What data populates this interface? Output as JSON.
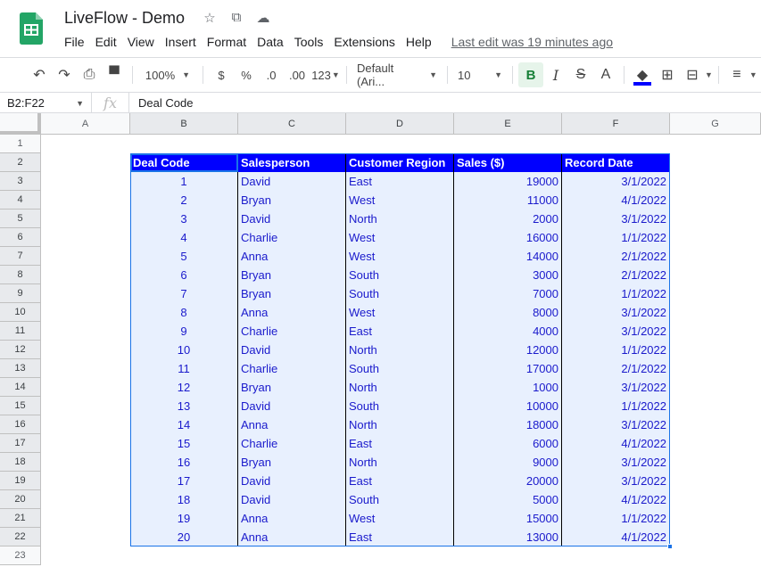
{
  "app": {
    "title": "LiveFlow - Demo",
    "title_icons": [
      "star-icon",
      "move-to-folder-icon",
      "cloud-saved-icon"
    ],
    "menu": [
      "File",
      "Edit",
      "View",
      "Insert",
      "Format",
      "Data",
      "Tools",
      "Extensions",
      "Help"
    ],
    "last_edit": "Last edit was 19 minutes ago"
  },
  "toolbar": {
    "undo": "↶",
    "redo": "↷",
    "print": "⎙",
    "paint_format": "🖌",
    "zoom": "100%",
    "currency": "$",
    "percent": "%",
    "decrease_decimal": ".0",
    "increase_decimal": ".00",
    "more_formats": "123",
    "font": "Default (Ari...",
    "font_size": "10",
    "bold": "B",
    "italic": "I",
    "strikethrough": "S",
    "text_color": "A",
    "fill_color": "#0000ff"
  },
  "formula_bar": {
    "name_box": "B2:F22",
    "fx": "fx",
    "value": "Deal Code"
  },
  "grid": {
    "columns": [
      "A",
      "B",
      "C",
      "D",
      "E",
      "F",
      "G"
    ],
    "rows": [
      "1",
      "2",
      "3",
      "4",
      "5",
      "6",
      "7",
      "8",
      "9",
      "10",
      "11",
      "12",
      "13",
      "14",
      "15",
      "16",
      "17",
      "18",
      "19",
      "20",
      "21",
      "22",
      "23"
    ],
    "selected_range": "B2:F22"
  },
  "table": {
    "headers": [
      "Deal Code",
      "Salesperson",
      "Customer Region",
      "Sales ($)",
      "Record Date"
    ],
    "rows": [
      [
        "1",
        "David",
        "East",
        "19000",
        "3/1/2022"
      ],
      [
        "2",
        "Bryan",
        "West",
        "11000",
        "4/1/2022"
      ],
      [
        "3",
        "David",
        "North",
        "2000",
        "3/1/2022"
      ],
      [
        "4",
        "Charlie",
        "West",
        "16000",
        "1/1/2022"
      ],
      [
        "5",
        "Anna",
        "West",
        "14000",
        "2/1/2022"
      ],
      [
        "6",
        "Bryan",
        "South",
        "3000",
        "2/1/2022"
      ],
      [
        "7",
        "Bryan",
        "South",
        "7000",
        "1/1/2022"
      ],
      [
        "8",
        "Anna",
        "West",
        "8000",
        "3/1/2022"
      ],
      [
        "9",
        "Charlie",
        "East",
        "4000",
        "3/1/2022"
      ],
      [
        "10",
        "David",
        "North",
        "12000",
        "1/1/2022"
      ],
      [
        "11",
        "Charlie",
        "South",
        "17000",
        "2/1/2022"
      ],
      [
        "12",
        "Bryan",
        "North",
        "1000",
        "3/1/2022"
      ],
      [
        "13",
        "David",
        "South",
        "10000",
        "1/1/2022"
      ],
      [
        "14",
        "Anna",
        "North",
        "18000",
        "3/1/2022"
      ],
      [
        "15",
        "Charlie",
        "East",
        "6000",
        "4/1/2022"
      ],
      [
        "16",
        "Bryan",
        "North",
        "9000",
        "3/1/2022"
      ],
      [
        "17",
        "David",
        "East",
        "20000",
        "3/1/2022"
      ],
      [
        "18",
        "David",
        "South",
        "5000",
        "4/1/2022"
      ],
      [
        "19",
        "Anna",
        "West",
        "15000",
        "1/1/2022"
      ],
      [
        "20",
        "Anna",
        "East",
        "13000",
        "4/1/2022"
      ]
    ]
  },
  "colors": {
    "header_fill": "#0000ff",
    "header_text": "#ffffff",
    "body_text": "#1a1acc",
    "selection": "#1a73e8"
  }
}
